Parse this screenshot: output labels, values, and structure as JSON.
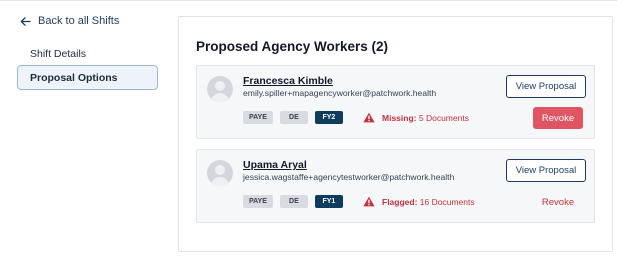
{
  "back_link": {
    "label": "Back to all Shifts",
    "icon": "arrow-left-icon"
  },
  "nav": {
    "items": [
      {
        "label": "Shift Details",
        "active": false
      },
      {
        "label": "Proposal Options",
        "active": true
      }
    ]
  },
  "panel": {
    "title": "Proposed Agency Workers (2)",
    "workers": [
      {
        "name": "Francesca Kimble",
        "email": "emily.spiller+mapagencyworker@patchwork.health",
        "tags": [
          "PAYE",
          "DE",
          "FY2"
        ],
        "alert_label": "Missing:",
        "alert_value": "5 Documents",
        "view_label": "View Proposal",
        "revoke_label": "Revoke"
      },
      {
        "name": "Upama Aryal",
        "email": "jessica.wagstaffe+agencytestworker@patchwork.health",
        "tags": [
          "PAYE",
          "DE",
          "FY1"
        ],
        "alert_label": "Flagged:",
        "alert_value": "16 Documents",
        "view_label": "View Proposal",
        "revoke_label": "Revoke"
      }
    ]
  },
  "colors": {
    "primary": "#1e3a5f",
    "danger": "#e05563",
    "alert_text": "#c2323f",
    "dark_tag": "#0f3b5c"
  }
}
